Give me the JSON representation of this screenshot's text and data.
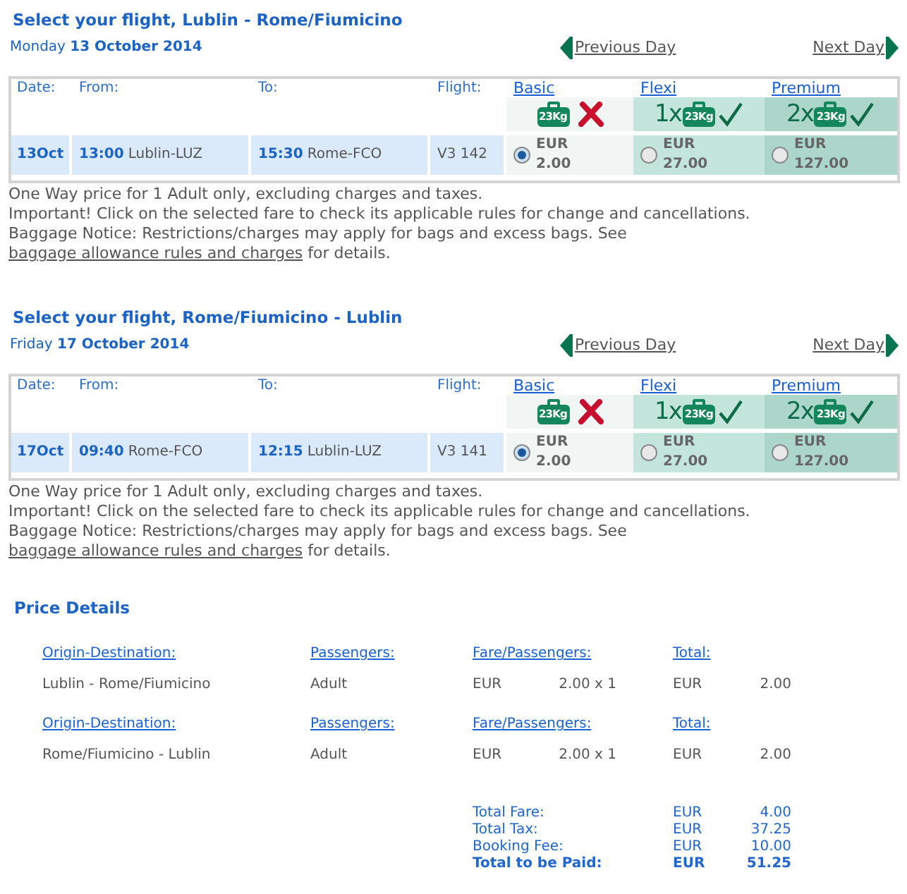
{
  "flights": [
    {
      "title": "Select your flight, Lublin - Rome/Fiumicino",
      "date": "Monday **13 October 2014**",
      "previous_day": "Previous Day",
      "next_day": "Next Day",
      "columns": [
        "Date:",
        "From:",
        "To:",
        "Flight:"
      ],
      "fares": [
        {
          "name": "Basic",
          "baggage": {
            "weight": "23Kg",
            "included": false
          },
          "currency": "EUR",
          "price": "2.00",
          "selected": true
        },
        {
          "name": "Flexi",
          "baggage": {
            "count": "1x",
            "weight": "23Kg",
            "included": true
          },
          "currency": "EUR",
          "price": "27.00",
          "selected": false
        },
        {
          "name": "Premium",
          "baggage": {
            "count": "2x",
            "weight": "23Kg",
            "included": true
          },
          "currency": "EUR",
          "price": "127.00",
          "selected": false
        }
      ],
      "row": {
        "date": "13Oct",
        "departure_time": "13:00",
        "origin": "Lublin-LUZ",
        "arrival_time": "15:30",
        "destination": "Rome-FCO",
        "flight": "V3 142"
      },
      "notes": [
        "One Way price for 1 Adult only, excluding charges and taxes.",
        "Important! Click on the selected fare to check its applicable rules for change and cancellations."
      ],
      "baggage_notice": {
        "text": "Baggage Notice: Restrictions/charges may apply for bags and excess bags. See",
        "link": "baggage allowance rules and charges",
        "after": "for details."
      }
    },
    {
      "title": "Select your flight, Rome/Fiumicino - Lublin",
      "date": "Friday **17 October 2014**",
      "previous_day": "Previous Day",
      "next_day": "Next Day",
      "columns": [
        "Date:",
        "From:",
        "To:",
        "Flight:"
      ],
      "fares": [
        {
          "name": "Basic",
          "baggage": {
            "weight": "23Kg",
            "included": false
          },
          "currency": "EUR",
          "price": "2.00",
          "selected": true
        },
        {
          "name": "Flexi",
          "baggage": {
            "count": "1x",
            "weight": "23Kg",
            "included": true
          },
          "currency": "EUR",
          "price": "27.00",
          "selected": false
        },
        {
          "name": "Premium",
          "baggage": {
            "count": "2x",
            "weight": "23Kg",
            "included": true
          },
          "currency": "EUR",
          "price": "127.00",
          "selected": false
        }
      ],
      "row": {
        "date": "17Oct",
        "departure_time": "09:40",
        "origin": "Rome-FCO",
        "arrival_time": "12:15",
        "destination": "Lublin-LUZ",
        "flight": "V3 141"
      },
      "notes": [
        "One Way price for 1 Adult only, excluding charges and taxes.",
        "Important! Click on the selected fare to check its applicable rules for change and cancellations."
      ],
      "baggage_notice": {
        "text": "Baggage Notice: Restrictions/charges may apply for bags and excess bags. See",
        "link": "baggage allowance rules and charges",
        "after": "for details."
      }
    }
  ],
  "price_details": {
    "title": "Price Details",
    "segments": [
      {
        "headers": [
          "Origin-Destination:",
          "Passengers:",
          "Fare/Passengers:",
          "Total:"
        ],
        "route": "Lublin - Rome/Fiumicino",
        "passenger": "Adult",
        "fare_currency": "EUR",
        "fare": "2.00 x 1",
        "total_currency": "EUR",
        "total": "2.00"
      },
      {
        "headers": [
          "Origin-Destination:",
          "Passengers:",
          "Fare/Passengers:",
          "Total:"
        ],
        "route": "Rome/Fiumicino - Lublin",
        "passenger": "Adult",
        "fare_currency": "EUR",
        "fare": "2.00 x 1",
        "total_currency": "EUR",
        "total": "2.00"
      }
    ],
    "totals": [
      {
        "kind": "subtotal",
        "label": "Total Fare:",
        "currency": "EUR",
        "amount": "4.00"
      },
      {
        "kind": "subtotal",
        "label": "Total Tax:",
        "currency": "EUR",
        "amount": "37.25"
      },
      {
        "kind": "subtotal",
        "label": "Booking Fee:",
        "currency": "EUR",
        "amount": "10.00"
      },
      {
        "kind": "grand_total",
        "label": "Total to be Paid:",
        "currency": "EUR",
        "amount": "51.25"
      }
    ]
  }
}
